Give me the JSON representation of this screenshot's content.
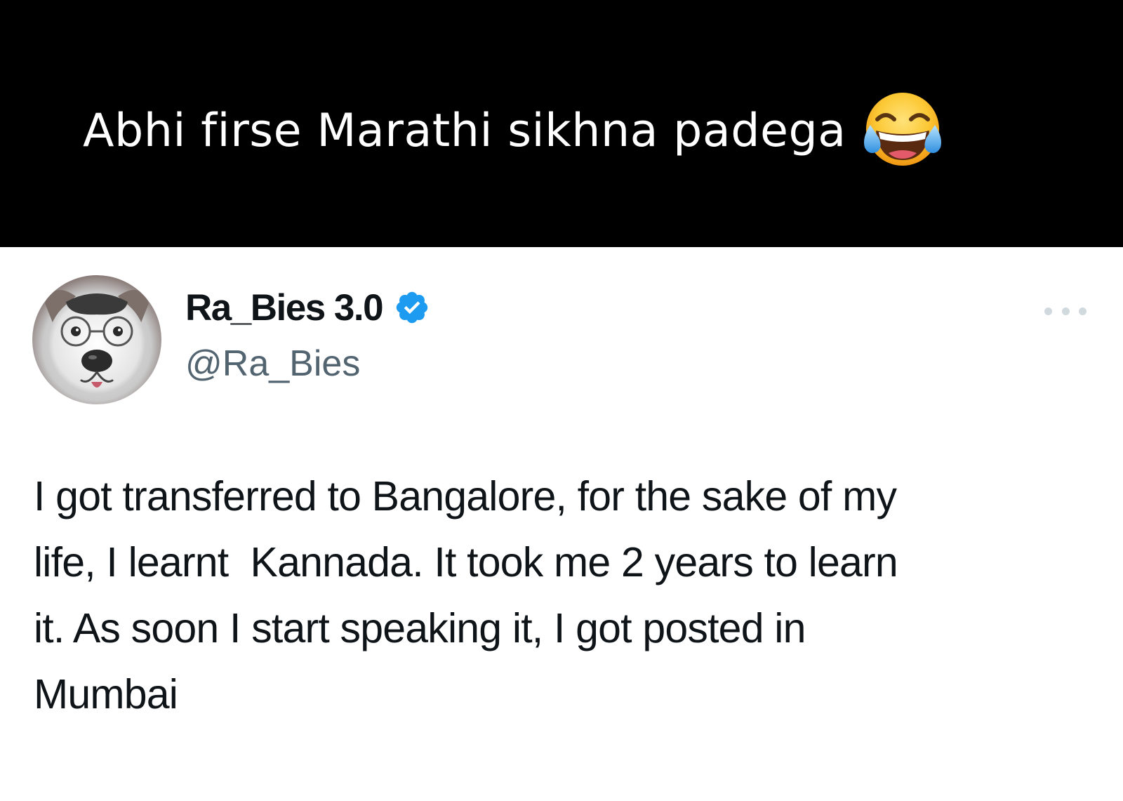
{
  "caption": {
    "text": "Abhi firse Marathi sikhna padega",
    "emoji_icon": "face-with-tears-of-joy-icon"
  },
  "tweet": {
    "author": {
      "display_name": "Ra_Bies 3.0",
      "handle": "@Ra_Bies",
      "verified": true,
      "verified_color": "#1d9bf0"
    },
    "more_icon": "more-horizontal-icon",
    "body_lines": [
      "I got transferred to Bangalore, for the sake of my",
      "life, I learnt  Kannada. It took me 2 years to learn",
      "it. As soon I start speaking it, I got posted in",
      "Mumbai"
    ]
  },
  "colors": {
    "banner_bg": "#000000",
    "banner_text": "#ffffff",
    "name_text": "#0f1419",
    "handle_text": "#536471",
    "more_dots": "#cfd9de"
  }
}
